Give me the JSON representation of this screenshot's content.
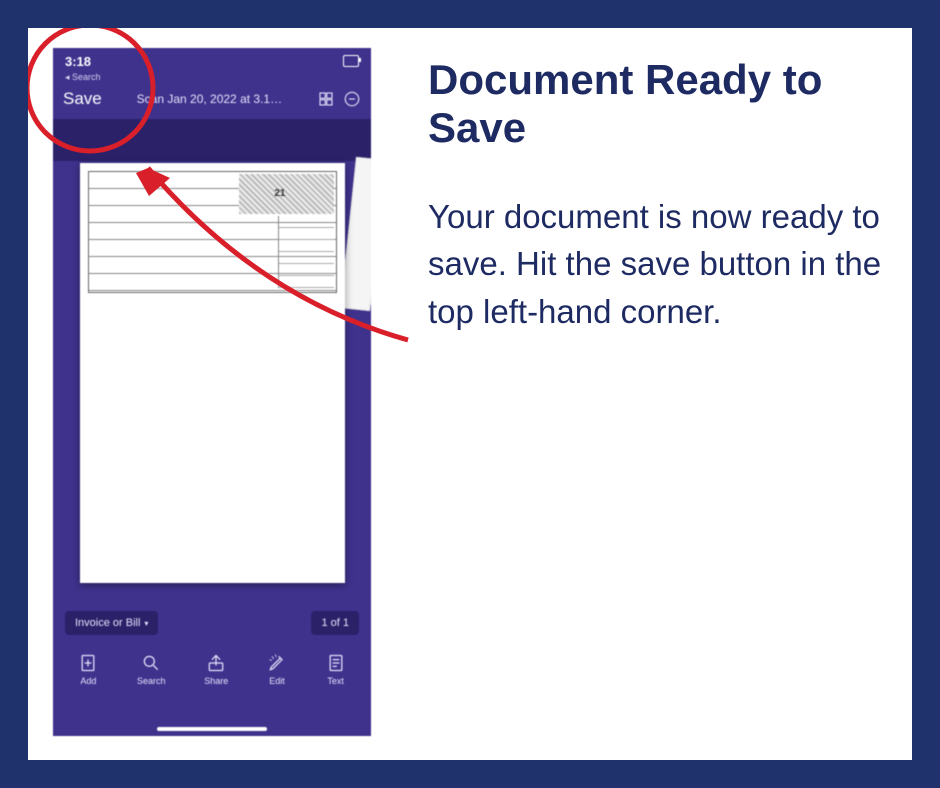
{
  "instruction": {
    "title": "Document Ready to Save",
    "body": "Your document is now ready to save. Hit the save button in the top left-hand corner."
  },
  "phone": {
    "status": {
      "time": "3:18",
      "back_hint": "Search"
    },
    "header": {
      "save_label": "Save",
      "scan_title": "Scan Jan 20, 2022 at 3.1…"
    },
    "form": {
      "year_label": "21"
    },
    "chips": {
      "category_label": "Invoice or Bill",
      "page_counter": "1 of 1"
    },
    "toolbar": {
      "add": "Add",
      "search": "Search",
      "share": "Share",
      "edit": "Edit",
      "text": "Text"
    }
  }
}
